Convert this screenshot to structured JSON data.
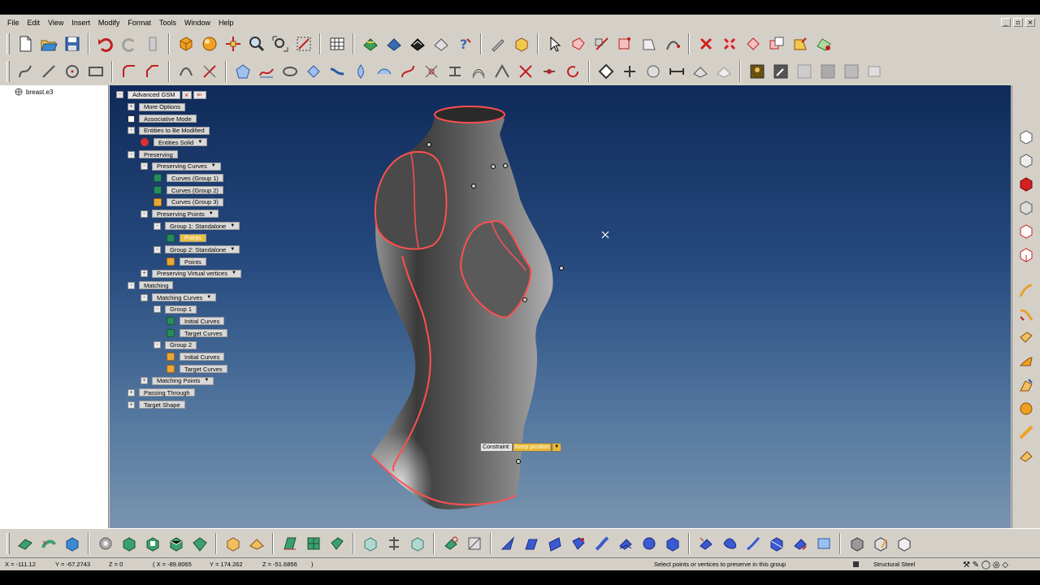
{
  "menu": [
    "File",
    "Edit",
    "View",
    "Insert",
    "Modify",
    "Format",
    "Tools",
    "Window",
    "Help"
  ],
  "tree": {
    "root_label": "breast.e3"
  },
  "options": {
    "title": "Advanced GSM",
    "rows": [
      {
        "label": "More Options",
        "exp": "+",
        "indent": 0
      },
      {
        "label": "Associative Mode",
        "chk": true,
        "indent": 0
      },
      {
        "label": "Entities to Be Modified",
        "exp": "-",
        "indent": 0
      },
      {
        "label": "Entities Solid",
        "icon": "red",
        "dd": true,
        "indent": 1
      },
      {
        "label": "Preserving",
        "exp": "-",
        "indent": 0
      },
      {
        "label": "Preserving Curves",
        "exp": "-",
        "dd": true,
        "indent": 1
      },
      {
        "label": "Curves (Group 1)",
        "icon": "green",
        "indent": 2
      },
      {
        "label": "Curves (Group 2)",
        "icon": "green",
        "indent": 2
      },
      {
        "label": "Curves (Group 3)",
        "icon": "orange",
        "indent": 2
      },
      {
        "label": "Preserving Points",
        "exp": "-",
        "dd": true,
        "indent": 1
      },
      {
        "label": "Group 1: Standalone",
        "exp": "-",
        "dd": true,
        "indent": 2
      },
      {
        "label": "Points",
        "icon": "green",
        "hl": true,
        "indent": 3
      },
      {
        "label": "Group 2: Standalone",
        "exp": "-",
        "dd": true,
        "indent": 2
      },
      {
        "label": "Points",
        "icon": "orange",
        "indent": 3
      },
      {
        "label": "Preserving Virtual vertices",
        "exp": "+",
        "dd": true,
        "indent": 1
      },
      {
        "label": "Matching",
        "exp": "-",
        "indent": 0
      },
      {
        "label": "Matching Curves",
        "exp": "-",
        "dd": true,
        "indent": 1
      },
      {
        "label": "Group 1",
        "exp": "-",
        "indent": 2
      },
      {
        "label": "Initial Curves",
        "icon": "green",
        "indent": 3
      },
      {
        "label": "Target Curves",
        "icon": "green",
        "indent": 3
      },
      {
        "label": "Group 2",
        "exp": "-",
        "indent": 2
      },
      {
        "label": "Initial Curves",
        "icon": "orange",
        "indent": 3
      },
      {
        "label": "Target Curves",
        "icon": "orange",
        "indent": 3
      },
      {
        "label": "Matching Points",
        "exp": "+",
        "dd": true,
        "indent": 1
      },
      {
        "label": "Passing Through",
        "exp": "+",
        "indent": 0
      },
      {
        "label": "Target Shape",
        "exp": "+",
        "indent": 0
      }
    ]
  },
  "constraint": {
    "label": "Constraint:",
    "value": "Keep position"
  },
  "status": {
    "x": "X = -111.12",
    "y": "Y = -67.2743",
    "z": "Z = 0",
    "x2": "( X = -89.8065",
    "y2": "Y = 174.262",
    "z2": "Z = -51.6856",
    "close": ")",
    "message": "Select points or vertices to preserve in this group",
    "material": "Structural Steel"
  },
  "colors": {
    "accent": "#e8b830",
    "curve": "#ff5050",
    "green": "#2a8a5a",
    "orange": "#e8a838"
  }
}
